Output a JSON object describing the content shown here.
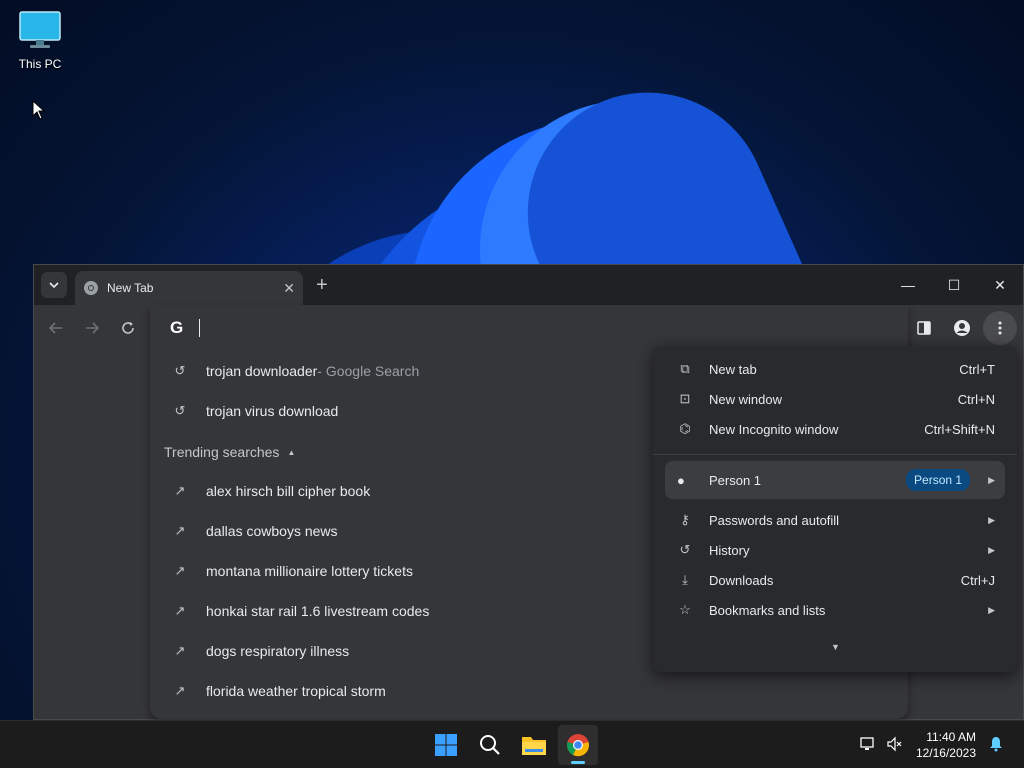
{
  "desktop": {
    "icons": [
      {
        "label": "This PC"
      }
    ]
  },
  "browser": {
    "tab": {
      "title": "New Tab"
    },
    "window_controls": {
      "minimize": "—",
      "maximize": "☐",
      "close": "✕"
    }
  },
  "omnibox": {
    "logo": "G",
    "history": [
      {
        "text": "trojan downloader",
        "suffix": " - Google Search"
      },
      {
        "text": "trojan virus download",
        "suffix": ""
      }
    ],
    "trending_header": "Trending searches",
    "trending": [
      "alex hirsch bill cipher book",
      "dallas cowboys news",
      "montana millionaire lottery tickets",
      "honkai star rail 1.6 livestream codes",
      "dogs respiratory illness",
      "florida weather tropical storm"
    ]
  },
  "menu": {
    "new_tab": {
      "label": "New tab",
      "shortcut": "Ctrl+T"
    },
    "new_window": {
      "label": "New window",
      "shortcut": "Ctrl+N"
    },
    "new_incognito": {
      "label": "New Incognito window",
      "shortcut": "Ctrl+Shift+N"
    },
    "person": {
      "label": "Person 1",
      "badge": "Person 1"
    },
    "passwords": {
      "label": "Passwords and autofill"
    },
    "history": {
      "label": "History"
    },
    "downloads": {
      "label": "Downloads",
      "shortcut": "Ctrl+J"
    },
    "bookmarks": {
      "label": "Bookmarks and lists"
    }
  },
  "taskbar": {
    "time": "11:40 AM",
    "date": "12/16/2023"
  },
  "colors": {
    "accent": "#60cdff",
    "browser_bg": "#35363a",
    "menu_bg": "#292a2d",
    "badge_bg": "#0b4a80"
  }
}
